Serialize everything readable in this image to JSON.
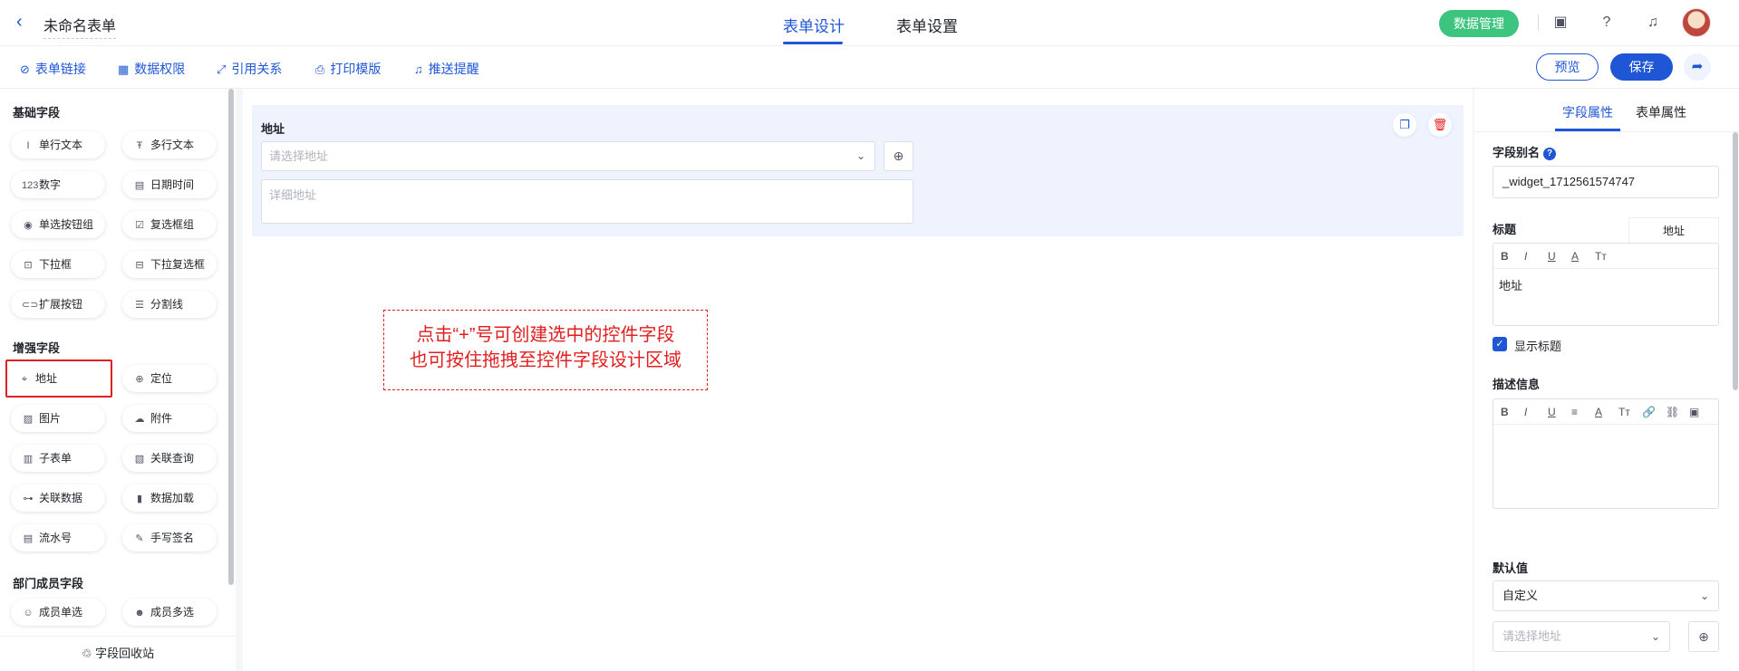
{
  "header": {
    "back_icon": "chevron-left-icon",
    "form_name": "未命名表单",
    "tabs": [
      {
        "label": "表单设计",
        "active": true
      },
      {
        "label": "表单设置",
        "active": false
      }
    ],
    "data_manage_label": "数据管理",
    "icons": [
      "contacts-icon",
      "help-icon",
      "bell-icon"
    ]
  },
  "toolbar": {
    "items": [
      {
        "label": "表单链接",
        "icon": "link-icon"
      },
      {
        "label": "数据权限",
        "icon": "permission-icon"
      },
      {
        "label": "引用关系",
        "icon": "relation-icon"
      },
      {
        "label": "打印模版",
        "icon": "printer-icon"
      },
      {
        "label": "推送提醒",
        "icon": "bell-icon"
      }
    ],
    "preview_label": "预览",
    "save_label": "保存",
    "share_icon": "share-icon"
  },
  "left_panel": {
    "sections": [
      {
        "title": "基础字段",
        "items": [
          "单行文本",
          "多行文本",
          "数字",
          "日期时间",
          "单选按钮组",
          "复选框组",
          "下拉框",
          "下拉复选框",
          "扩展按钮",
          "分割线"
        ]
      },
      {
        "title": "增强字段",
        "items": [
          "地址",
          "定位",
          "图片",
          "附件",
          "子表单",
          "关联查询",
          "关联数据",
          "数据加载",
          "流水号",
          "手写签名"
        ]
      },
      {
        "title": "部门成员字段",
        "items": [
          "成员单选",
          "成员多选"
        ]
      }
    ],
    "highlighted_item": "地址",
    "recycle_label": "字段回收站"
  },
  "canvas": {
    "field_label": "地址",
    "address_placeholder": "请选择地址",
    "detail_placeholder": "详细地址",
    "hint_line1": "点击“+”号可创建选中的控件字段",
    "hint_line2": "也可按住拖拽至控件字段设计区域"
  },
  "right_panel": {
    "tabs": [
      {
        "label": "字段属性",
        "active": true
      },
      {
        "label": "表单属性",
        "active": false
      }
    ],
    "alias_label": "字段别名",
    "alias_value": "_widget_1712561574747",
    "title_label": "标题",
    "title_tab": "地址",
    "title_tools": [
      "B",
      "I",
      "U",
      "A",
      "Tт"
    ],
    "title_value": "地址",
    "show_title_label": "显示标题",
    "show_title_checked": true,
    "desc_label": "描述信息",
    "desc_tools": [
      "B",
      "I",
      "U",
      "≡",
      "A",
      "Tт",
      "🔗",
      "⛓",
      "▣"
    ],
    "default_label": "默认值",
    "default_mode": "自定义",
    "default_address_placeholder": "请选择地址"
  },
  "colors": {
    "accent": "#1f56d6",
    "success": "#3dc47e",
    "highlight_red": "#e02020",
    "card_bg": "#eef3fe"
  }
}
